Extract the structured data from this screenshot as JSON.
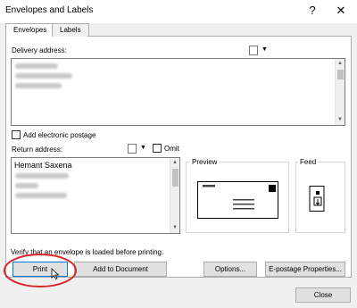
{
  "window": {
    "title": "Envelopes and Labels",
    "help_glyph": "?",
    "close_glyph": "✕"
  },
  "tabs": [
    {
      "label": "Envelopes"
    },
    {
      "label": "Labels"
    }
  ],
  "delivery": {
    "label": "Delivery address:"
  },
  "electronic_postage": {
    "label": "Add electronic postage"
  },
  "return": {
    "label": "Return address:",
    "first_line": "Hemant Saxena",
    "omit_label": "Omit"
  },
  "preview": {
    "label": "Preview"
  },
  "feed": {
    "label": "Feed"
  },
  "notice": "Verify that an envelope is loaded before printing.",
  "buttons": {
    "print": "Print",
    "add_to_document": "Add to Document",
    "options": "Options...",
    "epostage": "E-postage Properties...",
    "close": "Close"
  },
  "colors": {
    "highlight_ring": "#d9262c",
    "default_button_border": "#0078d7"
  },
  "icons": {
    "address_book": "address-book-icon",
    "dropdown": "chevron-down-icon",
    "cursor": "mouse-pointer-icon"
  }
}
